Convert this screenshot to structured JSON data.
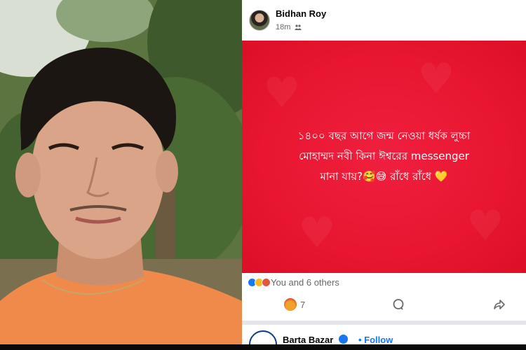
{
  "post": {
    "author": "Bidhan Roy",
    "time": "18m",
    "text_lines": [
      "১৪০০ বছর আগে জন্ম নেওয়া ধর্ষক লুচ্চা",
      "মোহাম্মদ নবী কিনা ঈশ্বরের messenger",
      "মানা যায়?🥰😅 রাঁধে রাঁধে 💛"
    ],
    "reactions_text": "You and 6 others",
    "angry_count": "7",
    "icons": {
      "audience": "friends-icon",
      "comment": "comment-icon",
      "share": "share-icon"
    },
    "colors": {
      "card_red": "#e8162f",
      "text": "#ffffff",
      "facebook_blue": "#1877f2"
    }
  },
  "next_post": {
    "page_name": "Barta Bazar",
    "follow_label": "• Follow"
  }
}
